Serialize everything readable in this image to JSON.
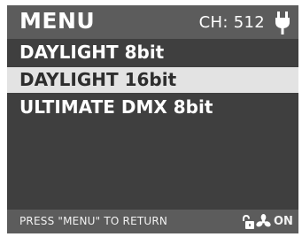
{
  "header": {
    "title": "MENU",
    "channel": "CH: 512",
    "icon": "plug-icon"
  },
  "menu": {
    "items": [
      {
        "label": "DAYLIGHT 8bit",
        "selected": false
      },
      {
        "label": "DAYLIGHT 16bit",
        "selected": true
      },
      {
        "label": "ULTIMATE DMX 8bit",
        "selected": false
      }
    ]
  },
  "footer": {
    "hint": "PRESS \"MENU\" TO RETURN",
    "lock_icon": "unlocked-padlock-icon",
    "fan_icon": "fan-icon",
    "fan_state": "ON"
  },
  "colors": {
    "screen_bg": "#3f3f3f",
    "bar_bg": "#5c5c5c",
    "selected_bg": "#e3e3e3",
    "text": "#ffffff"
  }
}
